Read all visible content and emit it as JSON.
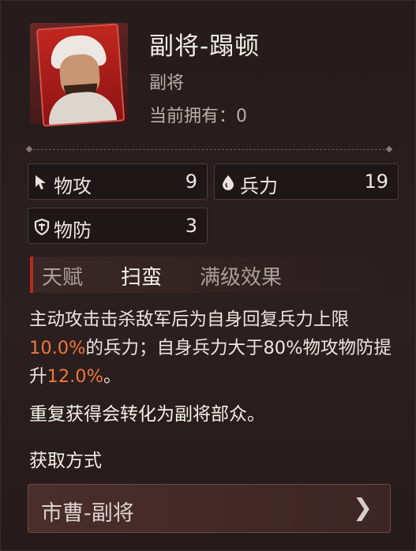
{
  "general": {
    "name": "副将-蹋顿",
    "type": "副将",
    "owned_label": "当前拥有：",
    "owned_count": "0"
  },
  "stats": [
    {
      "icon": "cursor-icon",
      "label": "物攻",
      "value": "9"
    },
    {
      "icon": "droplet-icon",
      "label": "兵力",
      "value": "19"
    },
    {
      "icon": "shield-icon",
      "label": "物防",
      "value": "3"
    }
  ],
  "talent": {
    "tag": "天赋",
    "name": "扫蛮",
    "effect_label": "满级效果"
  },
  "description": {
    "part1": "主动攻击击杀敌军后为自身回复兵力上限",
    "hl1": "10.0%",
    "part2": "的兵力；自身兵力大于80%物攻物防提升",
    "hl2": "12.0%",
    "part3": "。"
  },
  "convert_text": "重复获得会转化为副将部众。",
  "obtain": {
    "heading": "获取方式",
    "source_label": "市曹-副将"
  },
  "colors": {
    "accent_red": "#b52a22",
    "highlight": "#f0763c"
  }
}
